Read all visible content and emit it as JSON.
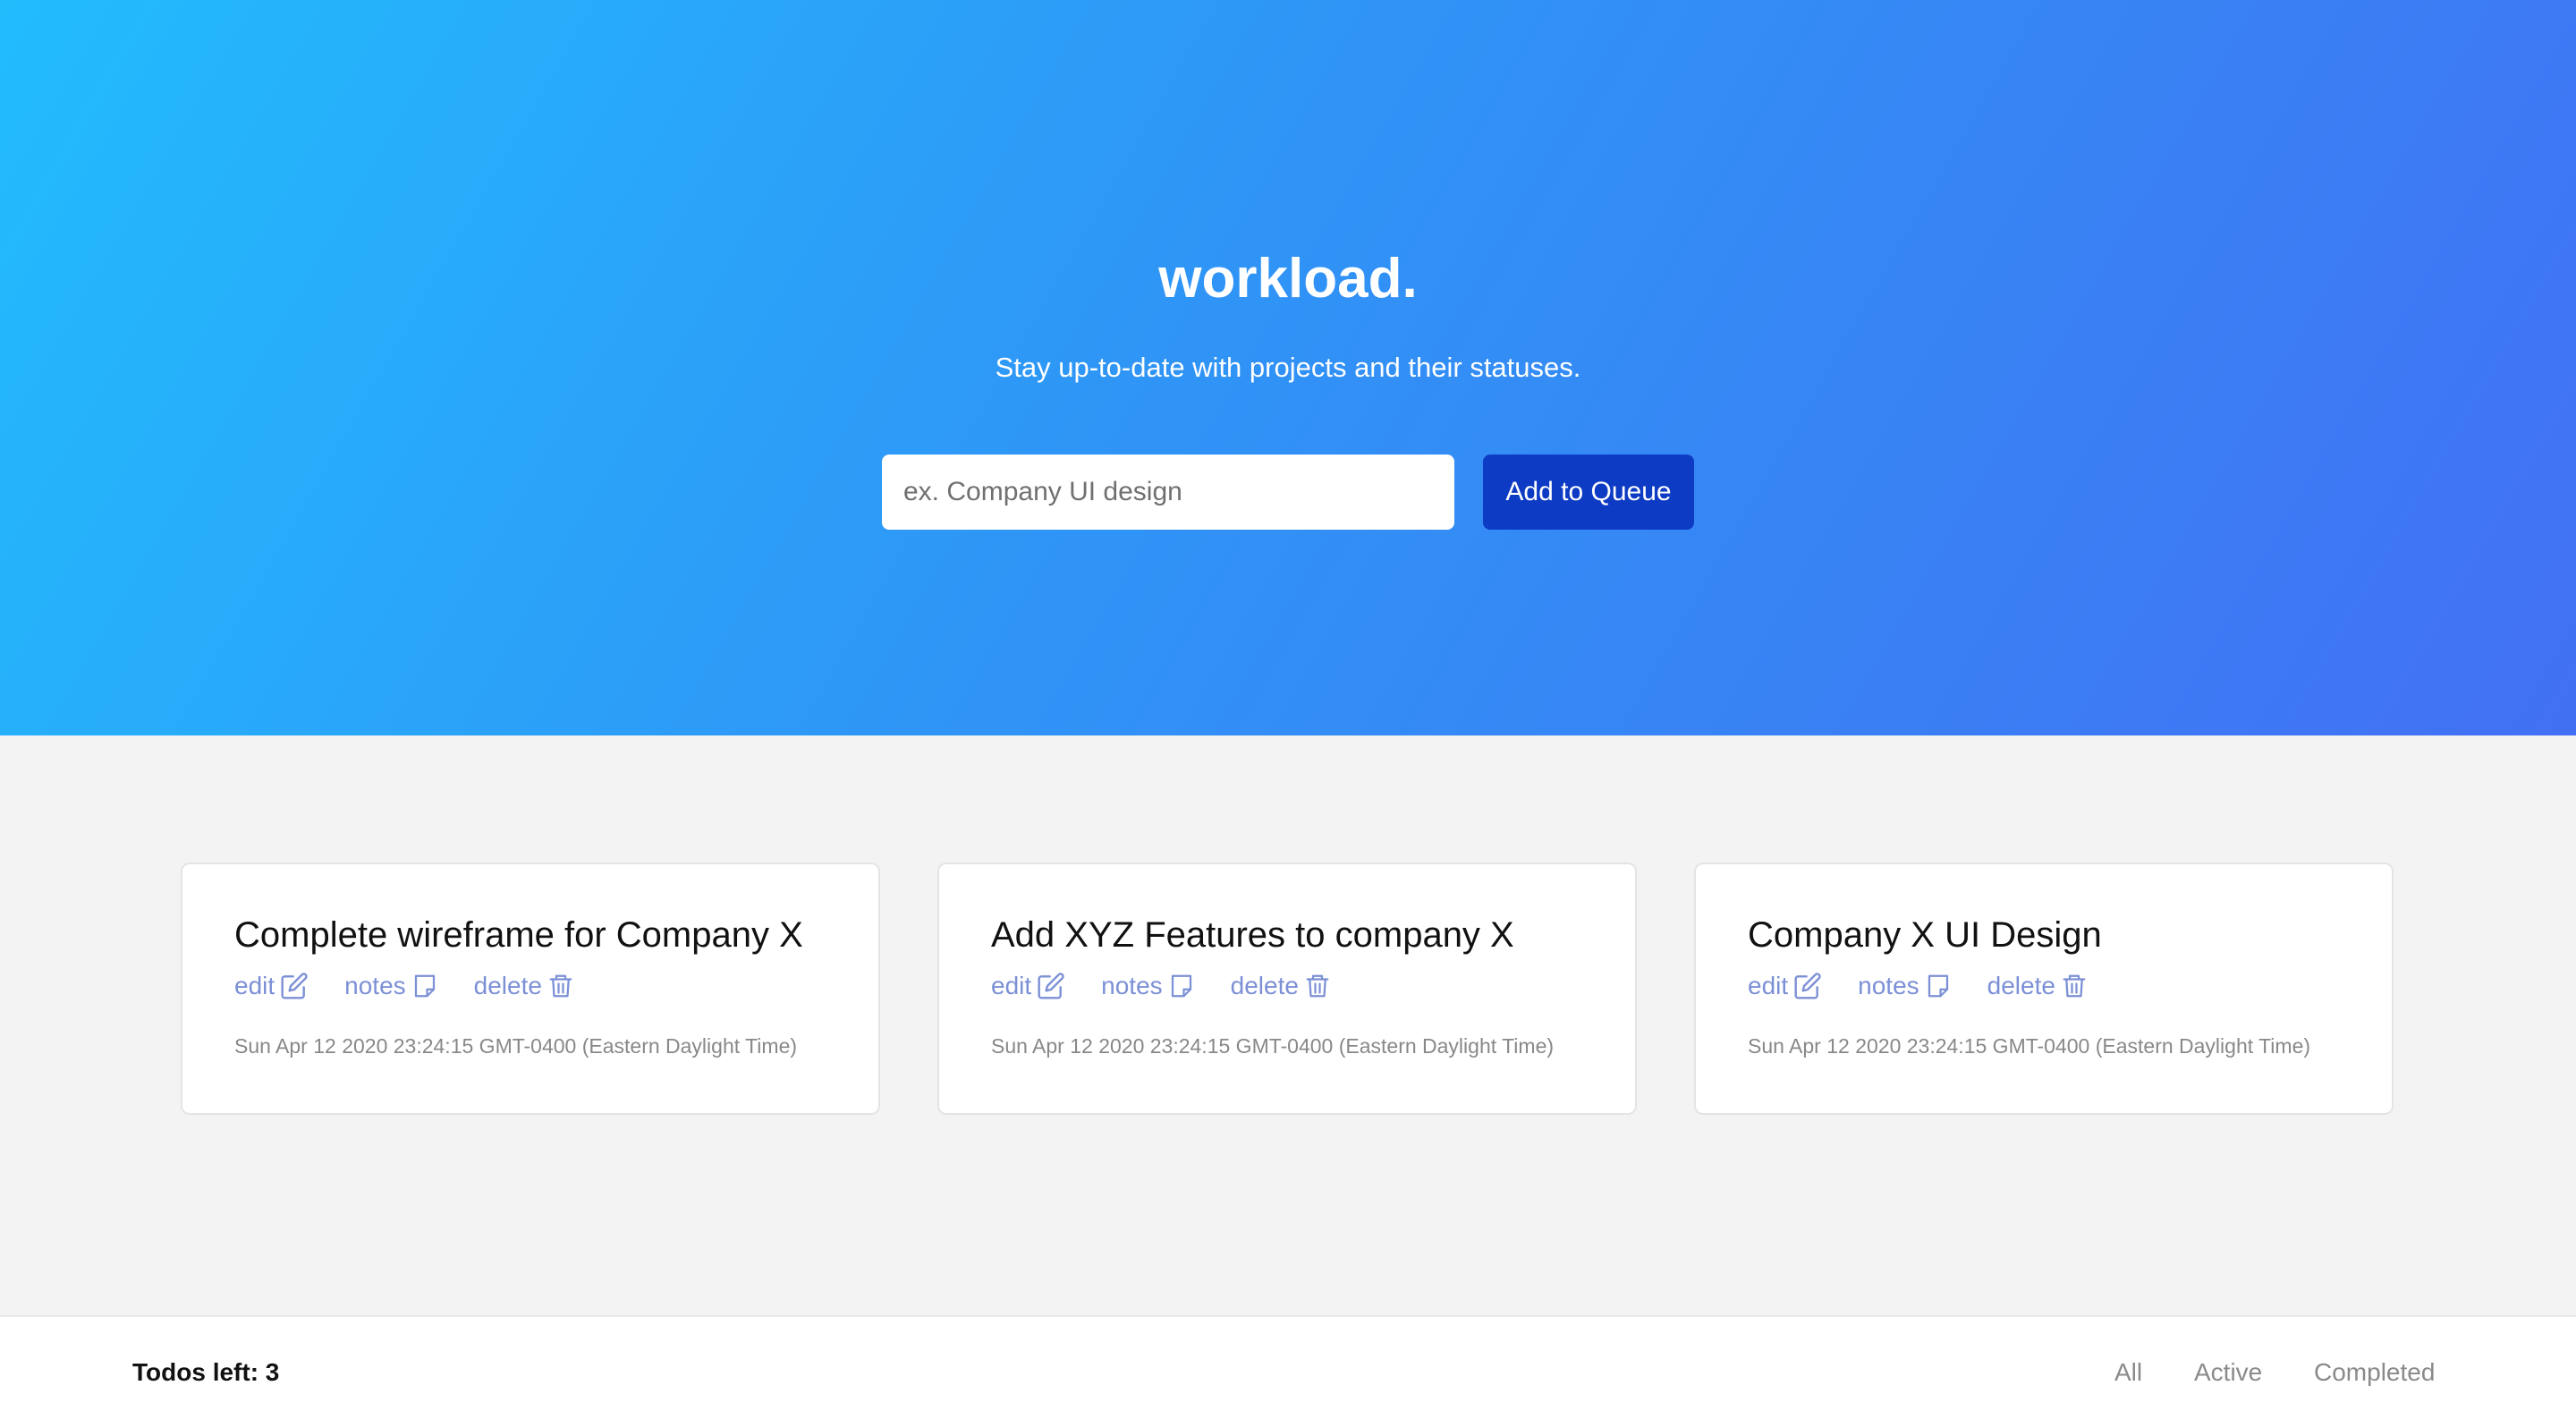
{
  "header": {
    "title": "workload.",
    "subtitle": "Stay up-to-date with projects and their statuses.",
    "input_placeholder": "ex. Company UI design",
    "input_value": "",
    "add_button_label": "Add to Queue"
  },
  "todos": [
    {
      "title": "Complete wireframe for Company X",
      "edit_label": "edit",
      "notes_label": "notes",
      "delete_label": "delete",
      "date": "Sun Apr 12 2020 23:24:15 GMT-0400 (Eastern Daylight Time)"
    },
    {
      "title": "Add XYZ Features to company X",
      "edit_label": "edit",
      "notes_label": "notes",
      "delete_label": "delete",
      "date": "Sun Apr 12 2020 23:24:15 GMT-0400 (Eastern Daylight Time)"
    },
    {
      "title": "Company X UI Design",
      "edit_label": "edit",
      "notes_label": "notes",
      "delete_label": "delete",
      "date": "Sun Apr 12 2020 23:24:15 GMT-0400 (Eastern Daylight Time)"
    }
  ],
  "footer": {
    "todos_left": "Todos left: 3",
    "filters": [
      "All",
      "Active",
      "Completed"
    ]
  },
  "colors": {
    "hero_gradient_start": "#22bcfd",
    "hero_gradient_end": "#4270f3",
    "button_bg": "#0d3bc4",
    "action_link": "#7c90d6",
    "page_bg": "#f3f3f3"
  },
  "icons": {
    "edit": "edit-icon",
    "notes": "note-icon",
    "delete": "trash-icon"
  }
}
